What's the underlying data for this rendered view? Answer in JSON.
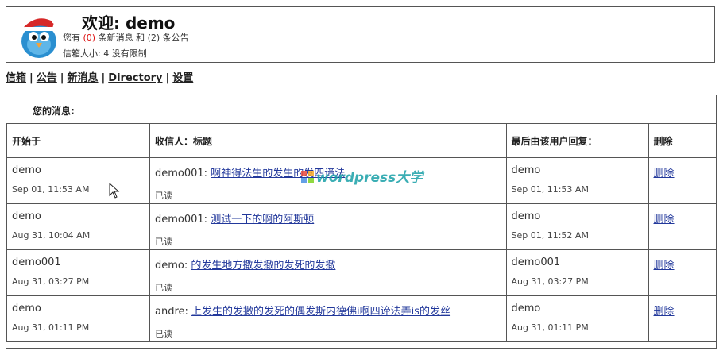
{
  "header": {
    "welcome": "欢迎: demo",
    "line1_prefix": "您有 ",
    "new_msg_count": "(0)",
    "line1_mid": " 条新消息 和 ",
    "announce_count": "(2)",
    "line1_suffix": " 条公告",
    "mailbox_size": "信箱大小: 4 没有限制"
  },
  "nav": {
    "items": [
      "信箱",
      "公告",
      "新消息",
      "Directory",
      "设置"
    ],
    "separator": "|"
  },
  "messages": {
    "title": "您的消息:",
    "columns": [
      "开始于",
      "收信人：标题",
      "最后由该用户回复：",
      "删除"
    ],
    "rows": [
      {
        "from": "demo",
        "from_date": "Sep 01, 11:53 AM",
        "to": "demo001:",
        "subject": "啊神得法生的发生的发四谛法",
        "status": "已读",
        "last_user": "demo",
        "last_date": "Sep 01, 11:53 AM",
        "delete": "删除"
      },
      {
        "from": "demo",
        "from_date": "Aug 31, 10:04 AM",
        "to": "demo001:",
        "subject": "测试一下的啊的阿斯顿",
        "status": "已读",
        "last_user": "demo",
        "last_date": "Sep 01, 11:52 AM",
        "delete": "删除"
      },
      {
        "from": "demo001",
        "from_date": "Aug 31, 03:27 PM",
        "to": "demo:",
        "subject": "的发生地方撒发撒的发死的发撒",
        "status": "已读",
        "last_user": "demo001",
        "last_date": "Aug 31, 03:27 PM",
        "delete": "删除"
      },
      {
        "from": "demo",
        "from_date": "Aug 31, 01:11 PM",
        "to": "andre:",
        "subject": "上发生的发撒的发死的偶发斯内德佛i啊四谛法弄is的发丝",
        "status": "已读",
        "last_user": "demo",
        "last_date": "Aug 31, 01:11 PM",
        "delete": "删除"
      }
    ]
  },
  "watermark": "wordpress大学",
  "colors": {
    "link": "#22389b",
    "count": "#d11111",
    "border": "#555555"
  }
}
